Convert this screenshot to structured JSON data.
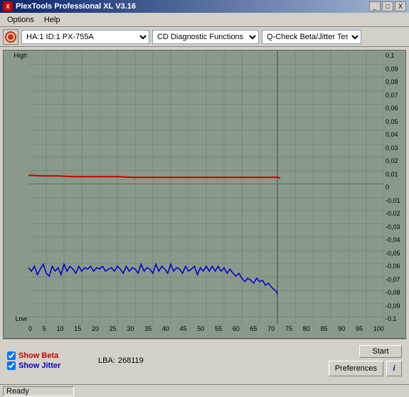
{
  "window": {
    "title": "PlexTools Professional XL V3.16",
    "title_icon": "X"
  },
  "titlebar": {
    "minimize_label": "_",
    "maximize_label": "□",
    "close_label": "X"
  },
  "menu": {
    "options_label": "Options",
    "help_label": "Help"
  },
  "toolbar": {
    "drive_value": "HA:1 ID:1  PX-755A",
    "function_value": "CD Diagnostic Functions",
    "test_value": "Q-Check Beta/Jitter Test"
  },
  "chart": {
    "y_left_high": "High",
    "y_left_low": "Low",
    "y_right_labels": [
      "0,1",
      "0,09",
      "0,08",
      "0,07",
      "0,06",
      "0,05",
      "0,04",
      "0,03",
      "0,02",
      "0,01",
      "0",
      "-0,01",
      "-0,02",
      "-0,03",
      "-0,04",
      "-0,05",
      "-0,06",
      "-0,07",
      "-0,08",
      "-0,09",
      "-0,1"
    ],
    "x_labels": [
      "0",
      "5",
      "10",
      "15",
      "20",
      "25",
      "30",
      "35",
      "40",
      "45",
      "50",
      "55",
      "60",
      "65",
      "70",
      "75",
      "80",
      "85",
      "90",
      "95",
      "100"
    ]
  },
  "controls": {
    "show_beta_label": "Show Beta",
    "show_beta_checked": true,
    "show_jitter_label": "Show Jitter",
    "show_jitter_checked": true,
    "lba_label": "LBA:",
    "lba_value": "268119",
    "start_btn": "Start",
    "preferences_btn": "Preferences",
    "info_btn": "i"
  },
  "status": {
    "text": "Ready"
  }
}
